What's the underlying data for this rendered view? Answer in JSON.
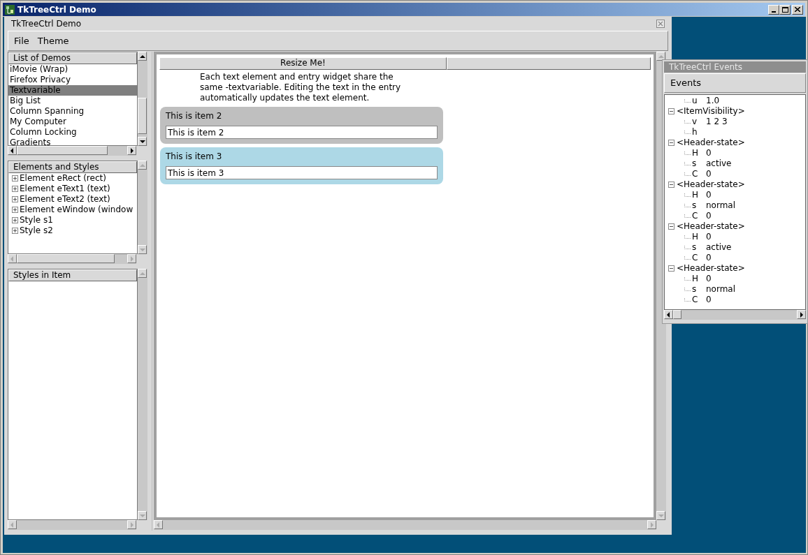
{
  "window": {
    "title": "TkTreeCtrl Demo"
  },
  "main_window": {
    "title": "TkTreeCtrl Demo",
    "menu": [
      "File",
      "Theme"
    ]
  },
  "demo_list": {
    "header": "List of Demos",
    "items": [
      {
        "label": "iMovie (Wrap)",
        "selected": false
      },
      {
        "label": "Firefox Privacy",
        "selected": false
      },
      {
        "label": "Textvariable",
        "selected": true
      },
      {
        "label": "Big List",
        "selected": false
      },
      {
        "label": "Column Spanning",
        "selected": false
      },
      {
        "label": "My Computer",
        "selected": false
      },
      {
        "label": "Column Locking",
        "selected": false
      },
      {
        "label": "Gradients",
        "selected": false
      }
    ]
  },
  "elements_and_styles": {
    "header": "Elements and Styles",
    "items": [
      {
        "label": "Element eRect (rect)",
        "expanded": false
      },
      {
        "label": "Element eText1 (text)",
        "expanded": false
      },
      {
        "label": "Element eText2 (text)",
        "expanded": false
      },
      {
        "label": "Element eWindow (window",
        "expanded": false
      },
      {
        "label": "Style s1",
        "expanded": false
      },
      {
        "label": "Style s2",
        "expanded": false
      }
    ]
  },
  "styles_in_item": {
    "header": "Styles in Item"
  },
  "demo_tree": {
    "columns": [
      "Resize Me!"
    ],
    "description": "Each text element and entry widget share the same -textvariable. Editing the text in the entry automatically updates the text element.",
    "items": [
      {
        "label": "This is item 2",
        "value": "This is item 2",
        "color": "#bfbfbf"
      },
      {
        "label": "This is item 3",
        "value": "This is item 3",
        "color": "#add8e6"
      }
    ]
  },
  "events_window": {
    "title": "TkTreeCtrl Events",
    "menu": [
      "Events"
    ],
    "leading_details": [
      {
        "key": "u",
        "value": "1.0"
      }
    ],
    "events": [
      {
        "name": "<ItemVisibility>",
        "expanded": true,
        "children": [
          {
            "key": "v",
            "value": "1 2 3"
          },
          {
            "key": "h"
          }
        ]
      },
      {
        "name": "<Header-state>",
        "expanded": true,
        "children": [
          {
            "key": "H",
            "value": "0"
          },
          {
            "key": "s",
            "value": "active"
          },
          {
            "key": "C",
            "value": "0"
          }
        ]
      },
      {
        "name": "<Header-state>",
        "expanded": true,
        "children": [
          {
            "key": "H",
            "value": "0"
          },
          {
            "key": "s",
            "value": "normal"
          },
          {
            "key": "C",
            "value": "0"
          }
        ]
      },
      {
        "name": "<Header-state>",
        "expanded": true,
        "children": [
          {
            "key": "H",
            "value": "0"
          },
          {
            "key": "s",
            "value": "active"
          },
          {
            "key": "C",
            "value": "0"
          }
        ]
      },
      {
        "name": "<Header-state>",
        "expanded": true,
        "children": [
          {
            "key": "H",
            "value": "0"
          },
          {
            "key": "s",
            "value": "normal"
          },
          {
            "key": "C",
            "value": "0"
          }
        ]
      }
    ]
  }
}
